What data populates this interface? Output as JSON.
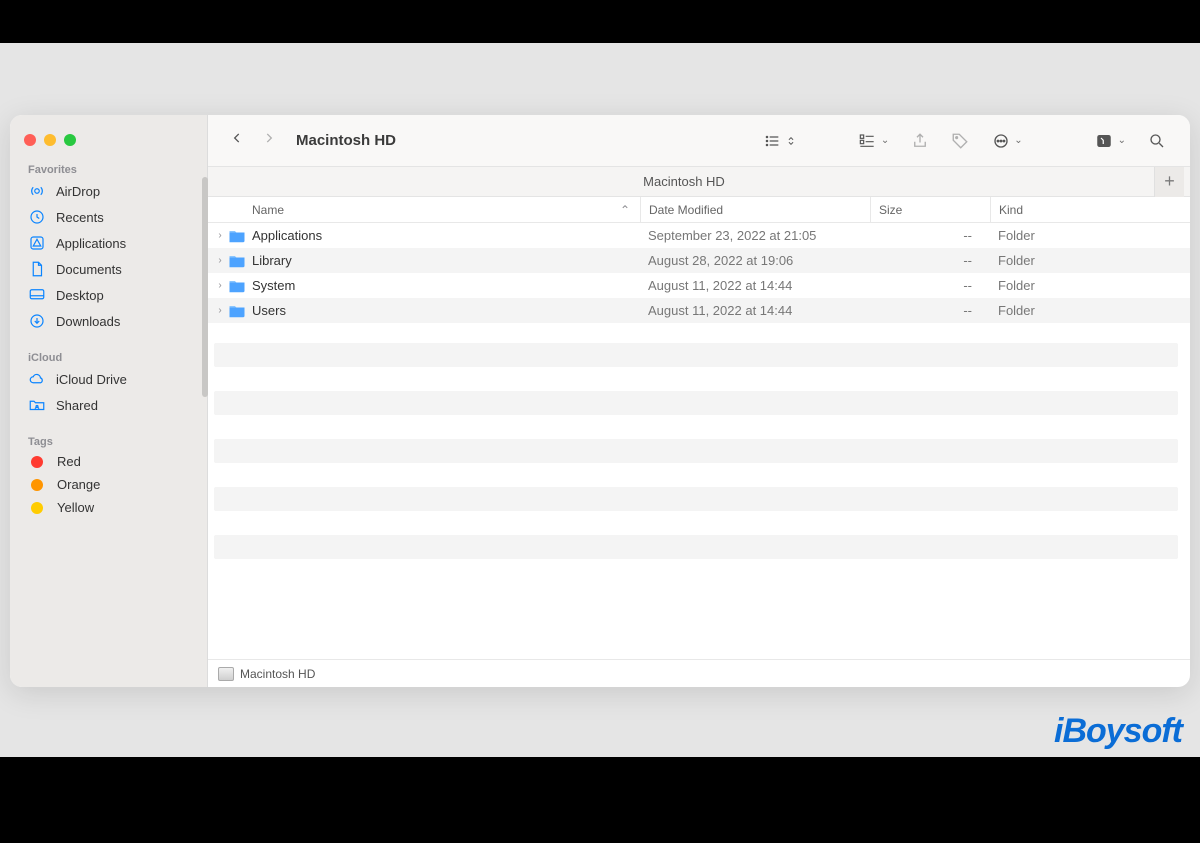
{
  "window": {
    "title": "Macintosh HD"
  },
  "tabs": {
    "active": "Macintosh HD"
  },
  "sidebar": {
    "sections": [
      {
        "label": "Favorites",
        "items": [
          {
            "icon": "airdrop",
            "label": "AirDrop"
          },
          {
            "icon": "clock",
            "label": "Recents"
          },
          {
            "icon": "app-grid",
            "label": "Applications"
          },
          {
            "icon": "doc",
            "label": "Documents"
          },
          {
            "icon": "desktop",
            "label": "Desktop"
          },
          {
            "icon": "download",
            "label": "Downloads"
          }
        ]
      },
      {
        "label": "iCloud",
        "items": [
          {
            "icon": "cloud",
            "label": "iCloud Drive"
          },
          {
            "icon": "shared",
            "label": "Shared"
          }
        ]
      },
      {
        "label": "Tags",
        "items": [
          {
            "tagColor": "#ff3b30",
            "label": "Red"
          },
          {
            "tagColor": "#ff9500",
            "label": "Orange"
          },
          {
            "tagColor": "#ffcc00",
            "label": "Yellow"
          }
        ]
      }
    ]
  },
  "columns": {
    "name": "Name",
    "date": "Date Modified",
    "size": "Size",
    "kind": "Kind"
  },
  "rows": [
    {
      "name": "Applications",
      "date": "September 23, 2022 at 21:05",
      "size": "--",
      "kind": "Folder"
    },
    {
      "name": "Library",
      "date": "August 28, 2022 at 19:06",
      "size": "--",
      "kind": "Folder"
    },
    {
      "name": "System",
      "date": "August 11, 2022 at 14:44",
      "size": "--",
      "kind": "Folder"
    },
    {
      "name": "Users",
      "date": "August 11, 2022 at 14:44",
      "size": "--",
      "kind": "Folder"
    }
  ],
  "pathbar": {
    "location": "Macintosh HD"
  },
  "watermark": "iBoysoft"
}
